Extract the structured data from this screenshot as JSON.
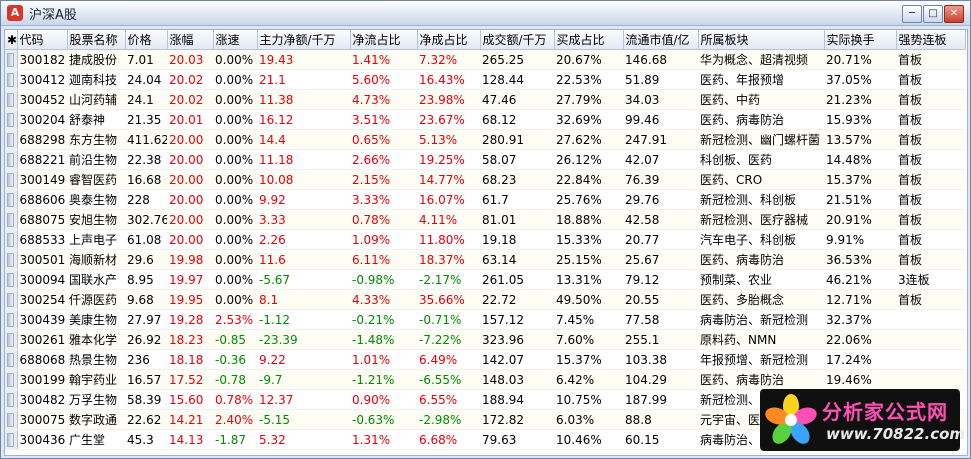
{
  "window": {
    "title": "沪深A股",
    "app_icon": "A"
  },
  "table": {
    "columns": [
      "代码",
      "股票名称",
      "价格",
      "涨幅",
      "涨速",
      "主力净额/千万",
      "净流占比",
      "净成占比",
      "成交额/千万",
      "买成占比",
      "流通市值/亿",
      "所属板块",
      "实际换手",
      "强势连板"
    ],
    "rows": [
      {
        "cells": [
          "300182",
          "捷成股份",
          "7.01",
          "20.03",
          "0.00%",
          "19.43",
          "1.41%",
          "7.32%",
          "265.25",
          "20.67%",
          "146.68",
          "华为概念、超清视频",
          "20.71%",
          "首板"
        ],
        "colors": [
          "",
          "",
          "",
          "red",
          "",
          "red",
          "red",
          "red",
          "",
          "",
          "",
          "",
          "",
          ""
        ]
      },
      {
        "cells": [
          "300412",
          "迦南科技",
          "24.04",
          "20.02",
          "0.00%",
          "21.1",
          "5.60%",
          "16.43%",
          "128.44",
          "22.53%",
          "51.89",
          "医药、年报预增",
          "37.05%",
          "首板"
        ],
        "colors": [
          "",
          "",
          "",
          "red",
          "",
          "red",
          "red",
          "red",
          "",
          "",
          "",
          "",
          "",
          ""
        ]
      },
      {
        "cells": [
          "300452",
          "山河药辅",
          "24.1",
          "20.02",
          "0.00%",
          "11.38",
          "4.73%",
          "23.98%",
          "47.46",
          "27.79%",
          "34.03",
          "医药、中药",
          "21.23%",
          "首板"
        ],
        "colors": [
          "",
          "",
          "",
          "red",
          "",
          "red",
          "red",
          "red",
          "",
          "",
          "",
          "",
          "",
          ""
        ]
      },
      {
        "cells": [
          "300204",
          "舒泰神",
          "21.35",
          "20.01",
          "0.00%",
          "16.12",
          "3.51%",
          "23.67%",
          "68.12",
          "32.69%",
          "99.46",
          "医药、病毒防治",
          "15.93%",
          "首板"
        ],
        "colors": [
          "",
          "",
          "",
          "red",
          "",
          "red",
          "red",
          "red",
          "",
          "",
          "",
          "",
          "",
          ""
        ]
      },
      {
        "cells": [
          "688298",
          "东方生物",
          "411.62",
          "20.00",
          "0.00%",
          "14.4",
          "0.65%",
          "5.13%",
          "280.91",
          "27.62%",
          "247.91",
          "新冠检测、幽门螺杆菌",
          "13.57%",
          "首板"
        ],
        "colors": [
          "",
          "",
          "",
          "red",
          "",
          "red",
          "red",
          "red",
          "",
          "",
          "",
          "",
          "",
          ""
        ]
      },
      {
        "cells": [
          "688221",
          "前沿生物",
          "22.38",
          "20.00",
          "0.00%",
          "11.18",
          "2.66%",
          "19.25%",
          "58.07",
          "26.12%",
          "42.07",
          "科创板、医药",
          "14.48%",
          "首板"
        ],
        "colors": [
          "",
          "",
          "",
          "red",
          "",
          "red",
          "red",
          "red",
          "",
          "",
          "",
          "",
          "",
          ""
        ]
      },
      {
        "cells": [
          "300149",
          "睿智医药",
          "16.68",
          "20.00",
          "0.00%",
          "10.08",
          "2.15%",
          "14.77%",
          "68.23",
          "22.84%",
          "76.39",
          "医药、CRO",
          "15.37%",
          "首板"
        ],
        "colors": [
          "",
          "",
          "",
          "red",
          "",
          "red",
          "red",
          "red",
          "",
          "",
          "",
          "",
          "",
          ""
        ]
      },
      {
        "cells": [
          "688606",
          "奥泰生物",
          "228",
          "20.00",
          "0.00%",
          "9.92",
          "3.33%",
          "16.07%",
          "61.7",
          "25.76%",
          "29.76",
          "新冠检测、科创板",
          "21.51%",
          "首板"
        ],
        "colors": [
          "",
          "",
          "",
          "red",
          "",
          "red",
          "red",
          "red",
          "",
          "",
          "",
          "",
          "",
          ""
        ]
      },
      {
        "cells": [
          "688075",
          "安旭生物",
          "302.76",
          "20.00",
          "0.00%",
          "3.33",
          "0.78%",
          "4.11%",
          "81.01",
          "18.88%",
          "42.58",
          "新冠检测、医疗器械",
          "20.91%",
          "首板"
        ],
        "colors": [
          "",
          "",
          "",
          "red",
          "",
          "red",
          "red",
          "red",
          "",
          "",
          "",
          "",
          "",
          ""
        ]
      },
      {
        "cells": [
          "688533",
          "上声电子",
          "61.08",
          "20.00",
          "0.00%",
          "2.26",
          "1.09%",
          "11.80%",
          "19.18",
          "15.33%",
          "20.77",
          "汽车电子、科创板",
          "9.91%",
          "首板"
        ],
        "colors": [
          "",
          "",
          "",
          "red",
          "",
          "red",
          "red",
          "red",
          "",
          "",
          "",
          "",
          "",
          ""
        ]
      },
      {
        "cells": [
          "300501",
          "海顺新材",
          "29.6",
          "19.98",
          "0.00%",
          "11.6",
          "6.11%",
          "18.37%",
          "63.14",
          "25.15%",
          "25.67",
          "医药、病毒防治",
          "36.53%",
          "首板"
        ],
        "colors": [
          "",
          "",
          "",
          "red",
          "",
          "red",
          "red",
          "red",
          "",
          "",
          "",
          "",
          "",
          ""
        ]
      },
      {
        "cells": [
          "300094",
          "国联水产",
          "8.95",
          "19.97",
          "0.00%",
          "-5.67",
          "-0.98%",
          "-2.17%",
          "261.05",
          "13.31%",
          "79.12",
          "预制菜、农业",
          "46.21%",
          "3连板"
        ],
        "colors": [
          "",
          "",
          "",
          "red",
          "",
          "green",
          "green",
          "green",
          "",
          "",
          "",
          "",
          "",
          ""
        ]
      },
      {
        "cells": [
          "300254",
          "仟源医药",
          "9.68",
          "19.95",
          "0.00%",
          "8.1",
          "4.33%",
          "35.66%",
          "22.72",
          "49.50%",
          "20.55",
          "医药、多胎概念",
          "12.71%",
          "首板"
        ],
        "colors": [
          "",
          "",
          "",
          "red",
          "",
          "red",
          "red",
          "red",
          "",
          "",
          "",
          "",
          "",
          ""
        ]
      },
      {
        "cells": [
          "300439",
          "美康生物",
          "27.97",
          "19.28",
          "2.53%",
          "-1.12",
          "-0.21%",
          "-0.71%",
          "157.12",
          "7.45%",
          "77.58",
          "病毒防治、新冠检测",
          "32.37%",
          ""
        ],
        "colors": [
          "",
          "",
          "",
          "red",
          "red",
          "green",
          "green",
          "green",
          "",
          "",
          "",
          "",
          "",
          ""
        ]
      },
      {
        "cells": [
          "300261",
          "雅本化学",
          "26.92",
          "18.23",
          "-0.85",
          "-23.39",
          "-1.48%",
          "-7.22%",
          "323.96",
          "7.60%",
          "255.1",
          "原料药、NMN",
          "22.06%",
          ""
        ],
        "colors": [
          "",
          "",
          "",
          "red",
          "green",
          "green",
          "green",
          "green",
          "",
          "",
          "",
          "",
          "",
          ""
        ]
      },
      {
        "cells": [
          "688068",
          "热景生物",
          "236",
          "18.18",
          "-0.36",
          "9.22",
          "1.01%",
          "6.49%",
          "142.07",
          "15.37%",
          "103.38",
          "年报预增、新冠检测",
          "17.24%",
          ""
        ],
        "colors": [
          "",
          "",
          "",
          "red",
          "green",
          "red",
          "red",
          "red",
          "",
          "",
          "",
          "",
          "",
          ""
        ]
      },
      {
        "cells": [
          "300199",
          "翰宇药业",
          "16.57",
          "17.52",
          "-0.78",
          "-9.7",
          "-1.21%",
          "-6.55%",
          "148.03",
          "6.42%",
          "104.29",
          "医药、病毒防治",
          "19.46%",
          ""
        ],
        "colors": [
          "",
          "",
          "",
          "red",
          "green",
          "green",
          "green",
          "green",
          "",
          "",
          "",
          "",
          "",
          ""
        ]
      },
      {
        "cells": [
          "300482",
          "万孚生物",
          "58.39",
          "15.60",
          "0.78%",
          "12.37",
          "0.90%",
          "6.55%",
          "188.94",
          "10.75%",
          "187.99",
          "新冠检测、病毒防治",
          "",
          ""
        ],
        "colors": [
          "",
          "",
          "",
          "red",
          "red",
          "red",
          "red",
          "red",
          "",
          "",
          "",
          "",
          "",
          ""
        ]
      },
      {
        "cells": [
          "300075",
          "数字政通",
          "22.62",
          "14.21",
          "2.40%",
          "-5.15",
          "-0.63%",
          "-2.98%",
          "172.82",
          "6.03%",
          "88.8",
          "元宇宙、医",
          "",
          ""
        ],
        "colors": [
          "",
          "",
          "",
          "red",
          "red",
          "green",
          "green",
          "green",
          "",
          "",
          "",
          "",
          "",
          ""
        ]
      },
      {
        "cells": [
          "300436",
          "广生堂",
          "45.3",
          "14.13",
          "-1.87",
          "5.32",
          "1.31%",
          "6.68%",
          "79.63",
          "10.46%",
          "60.15",
          "病毒防治、",
          "",
          ""
        ],
        "colors": [
          "",
          "",
          "",
          "red",
          "green",
          "red",
          "red",
          "red",
          "",
          "",
          "",
          "",
          "",
          ""
        ]
      }
    ]
  },
  "watermark": {
    "title": "分析家公式网",
    "url": "www.70822.com"
  }
}
